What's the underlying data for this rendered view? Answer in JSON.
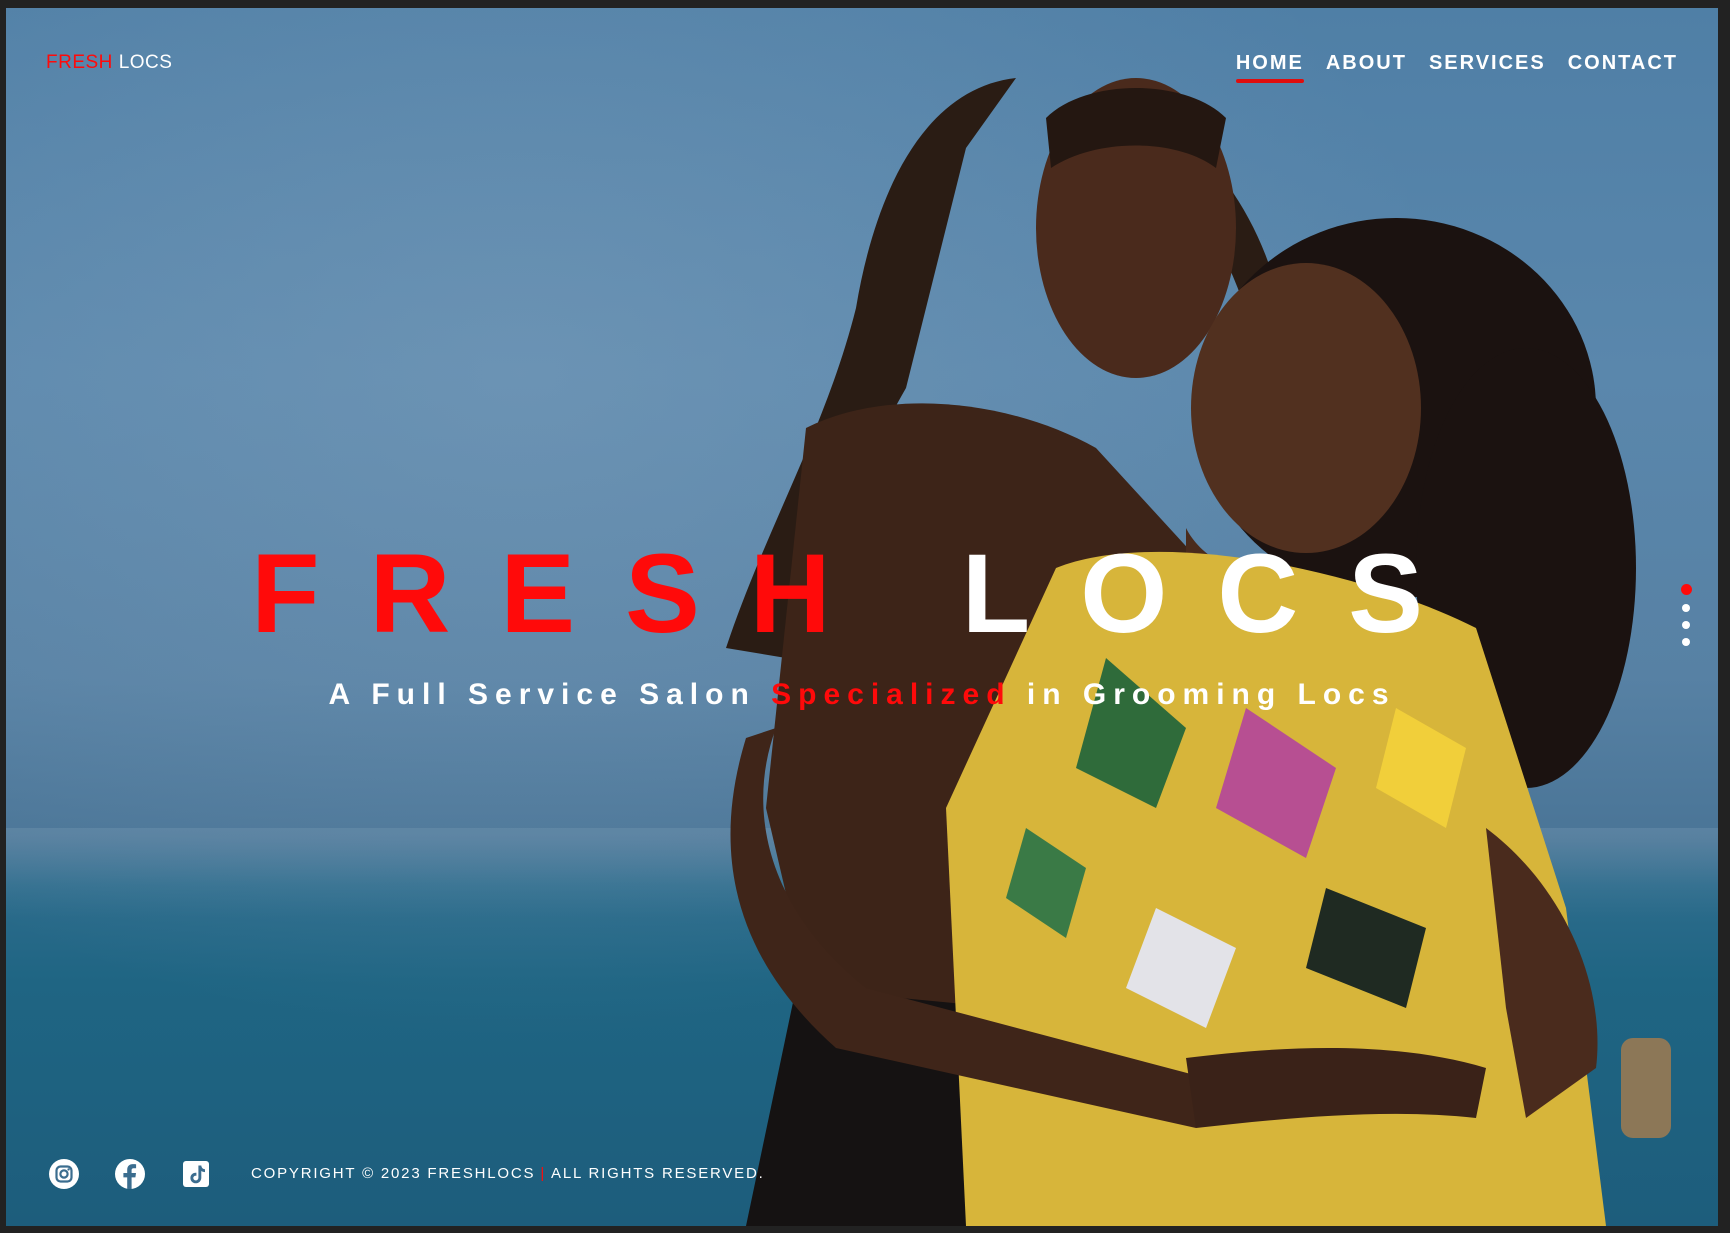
{
  "header": {
    "logo_part1": "FRESH",
    "logo_part2": "LOCS",
    "nav": [
      {
        "label": "HOME",
        "active": true
      },
      {
        "label": "ABOUT",
        "active": false
      },
      {
        "label": "SERVICES",
        "active": false
      },
      {
        "label": "CONTACT",
        "active": false
      }
    ]
  },
  "hero": {
    "title_part1": "FRESH",
    "title_part2": "LOCS",
    "tagline_part1": "A Full Service Salon",
    "tagline_highlight": "Specialized",
    "tagline_part2": "in Grooming Locs"
  },
  "slider": {
    "count": 4,
    "active_index": 0
  },
  "footer": {
    "social_icons": [
      "instagram-icon",
      "facebook-icon",
      "tiktok-icon"
    ],
    "copyright": "COPYRIGHT © 2023 FRESHLOCS",
    "separator": "|",
    "rights": "ALL RIGHTS RESERVED."
  },
  "colors": {
    "accent": "#ff0a0a",
    "text": "#ffffff",
    "sky": "#5a87ac",
    "sea": "#1f6583"
  }
}
